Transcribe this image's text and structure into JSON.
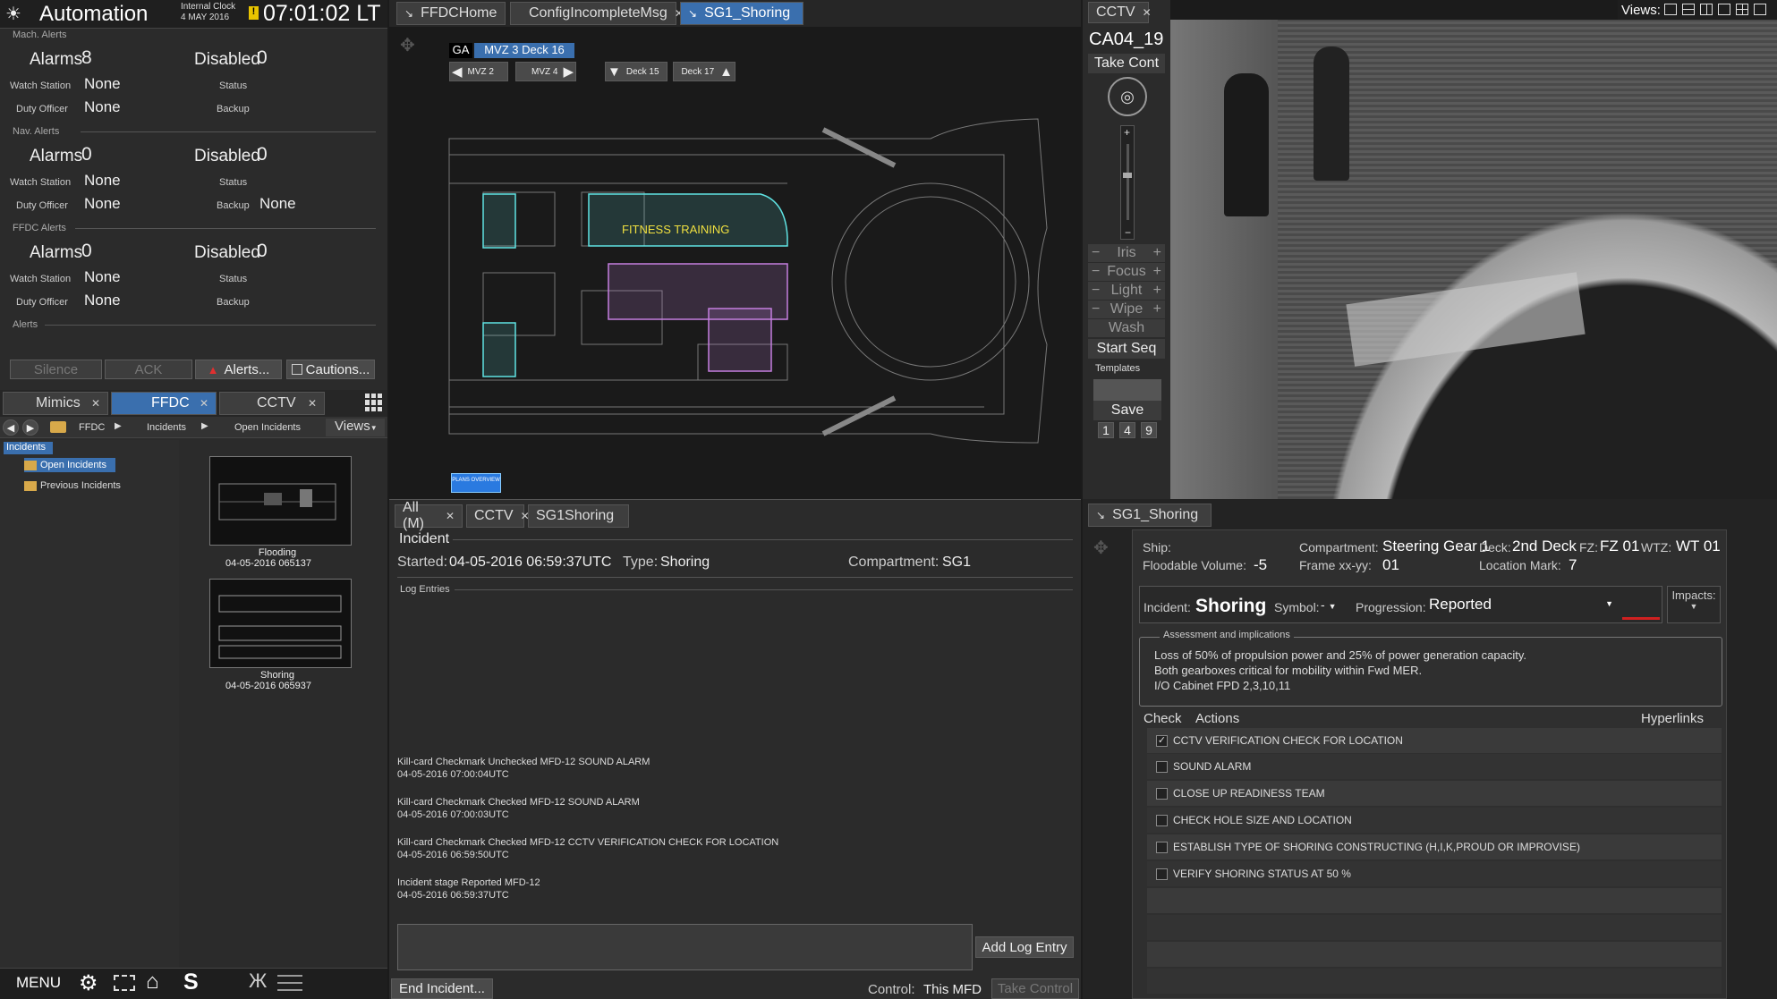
{
  "topbar": {
    "app_title": "Automation",
    "clock_label": "Internal Clock",
    "clock_date": "4 MAY 2016",
    "clock_time": "07:01:02 LT"
  },
  "alerts": {
    "mach": {
      "section": "Mach. Alerts",
      "alarms_label": "Alarms",
      "alarms": "8",
      "disabled_label": "Disabled",
      "disabled": "0",
      "watch_label": "Watch Station",
      "watch": "None",
      "status_label": "Status",
      "duty_label": "Duty Officer",
      "duty": "None",
      "backup_label": "Backup",
      "backup": ""
    },
    "nav": {
      "section": "Nav. Alerts",
      "alarms_label": "Alarms",
      "alarms": "0",
      "disabled_label": "Disabled",
      "disabled": "0",
      "watch_label": "Watch Station",
      "watch": "None",
      "status_label": "Status",
      "duty_label": "Duty Officer",
      "duty": "None",
      "backup_label": "Backup",
      "backup": "None"
    },
    "ffdc": {
      "section": "FFDC Alerts",
      "alarms_label": "Alarms",
      "alarms": "0",
      "disabled_label": "Disabled",
      "disabled": "0",
      "watch_label": "Watch Station",
      "watch": "None",
      "status_label": "Status",
      "duty_label": "Duty Officer",
      "duty": "None",
      "backup_label": "Backup",
      "backup": ""
    },
    "alerts_section": "Alerts",
    "buttons": {
      "silence": "Silence",
      "ack": "ACK",
      "alerts": "Alerts...",
      "cautions": "Cautions..."
    }
  },
  "left_tabs": [
    "Mimics",
    "FFDC",
    "CCTV"
  ],
  "breadcrumb": {
    "items": [
      "FFDC",
      "Incidents",
      "Open Incidents"
    ],
    "views": "Views"
  },
  "tree": {
    "header": "Incidents",
    "items": [
      "Open Incidents",
      "Previous Incidents"
    ]
  },
  "thumbs": [
    {
      "title": "Flooding",
      "time": "04-05-2016 065137"
    },
    {
      "title": "Shoring",
      "time": "04-05-2016 065937"
    }
  ],
  "bottom_bar": {
    "menu": "MENU",
    "s": "S"
  },
  "center_tabs": [
    "FFDCHome",
    "ConfigIncompleteMsg",
    "SG1_Shoring"
  ],
  "map": {
    "ga": "GA",
    "deck_label": "MVZ 3 Deck 16",
    "nav_buttons": [
      "MVZ 2",
      "MVZ 4",
      "Deck 15",
      "Deck 17"
    ],
    "area_label": "FITNESS TRAINING",
    "plans_btn": "PLANS OVERVIEW"
  },
  "incident": {
    "tabs": [
      "All (M)",
      "CCTV",
      "SG1Shoring"
    ],
    "heading": "Incident",
    "started_label": "Started:",
    "started": "04-05-2016 06:59:37UTC",
    "type_label": "Type:",
    "type": "Shoring",
    "compartment_label": "Compartment:",
    "compartment": "SG1",
    "log_heading": "Log Entries",
    "log": [
      {
        "text": "Kill-card Checkmark Unchecked MFD-12 SOUND ALARM",
        "time": "04-05-2016 07:00:04UTC"
      },
      {
        "text": "Kill-card Checkmark Checked MFD-12 SOUND ALARM",
        "time": "04-05-2016 07:00:03UTC"
      },
      {
        "text": "Kill-card Checkmark Checked MFD-12 CCTV VERIFICATION CHECK FOR LOCATION",
        "time": "04-05-2016 06:59:50UTC"
      },
      {
        "text": "Incident stage Reported MFD-12",
        "time": "04-05-2016 06:59:37UTC"
      }
    ],
    "add_log": "Add Log Entry",
    "end_incident": "End Incident...",
    "control_label": "Control:",
    "control": "This MFD",
    "take_control": "Take Control"
  },
  "cctv": {
    "tab": "CCTV",
    "camera": "CA04_19",
    "take_cont": "Take Cont",
    "controls": [
      "Iris",
      "Focus",
      "Light",
      "Wipe"
    ],
    "wash": "Wash",
    "start_seq": "Start Seq",
    "templates": "Templates",
    "save": "Save",
    "presets": [
      "1",
      "4",
      "9"
    ],
    "views_label": "Views:"
  },
  "shoring": {
    "tab": "SG1_Shoring",
    "ship_label": "Ship:",
    "ship": "",
    "compartment_label": "Compartment:",
    "compartment": "Steering Gear 1",
    "deck_label": "Deck:",
    "deck": "2nd Deck",
    "fz_label": "FZ:",
    "fz": "FZ 01",
    "wtz_label": "WTZ:",
    "wtz": "WT 01",
    "flood_label": "Floodable Volume:",
    "flood": "-5",
    "frame_label": "Frame xx-yy:",
    "frame": "01",
    "loc_label": "Location Mark:",
    "loc": "7",
    "incident_label": "Incident:",
    "incident": "Shoring",
    "symbol_label": "Symbol:",
    "symbol": "-",
    "progression_label": "Progression:",
    "progression": "Reported",
    "impacts_label": "Impacts:",
    "assess_heading": "Assessment and implications",
    "assess_lines": [
      "Loss of 50% of propulsion power and 25% of power generation capacity.",
      "Both gearboxes critical for mobility within Fwd MER.",
      "I/O Cabinet FPD 2,3,10,11"
    ],
    "col_check": "Check",
    "col_actions": "Actions",
    "col_links": "Hyperlinks",
    "checklist": [
      {
        "label": "CCTV VERIFICATION CHECK FOR LOCATION",
        "checked": true
      },
      {
        "label": "SOUND ALARM",
        "checked": false
      },
      {
        "label": "CLOSE UP READINESS TEAM",
        "checked": false
      },
      {
        "label": "CHECK  HOLE SIZE AND LOCATION",
        "checked": false
      },
      {
        "label": "ESTABLISH  TYPE OF SHORING CONSTRUCTING (H,I,K,PROUD OR IMPROVISE)",
        "checked": false
      },
      {
        "label": "VERIFY SHORING STATUS AT 50 %",
        "checked": false
      }
    ]
  },
  "colors": {
    "accent": "#3a6fae",
    "alert_red": "#d02020",
    "map_cyan": "#5fe3e3"
  }
}
